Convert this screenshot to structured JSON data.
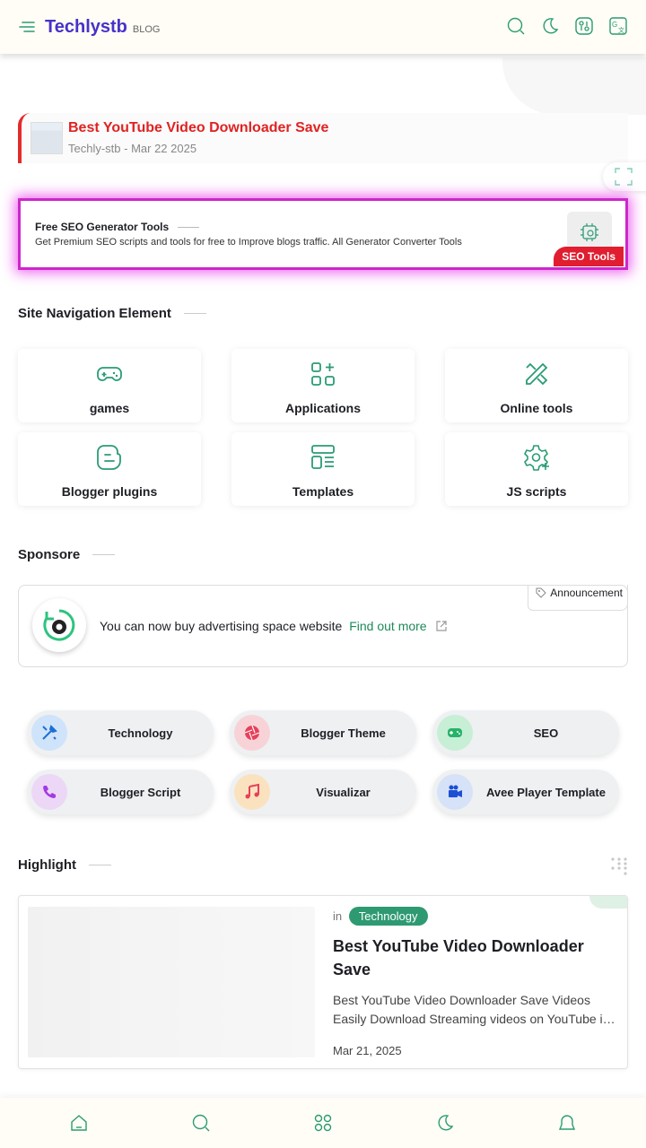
{
  "header": {
    "brand": "Techlystb",
    "brand_sub": "BLOG"
  },
  "recent_post": {
    "title": "Best YouTube Video Downloader Save",
    "meta": "Techly-stb - Mar 22 2025"
  },
  "seo_promo": {
    "title": "Free SEO Generator Tools",
    "description": "Get Premium SEO scripts and tools for free to Improve blogs traffic. All Generator Converter Tools",
    "badge": "SEO Tools"
  },
  "site_nav": {
    "heading": "Site Navigation Element",
    "items": [
      {
        "label": "games",
        "icon": "gamepad-icon"
      },
      {
        "label": "Applications",
        "icon": "apps-grid-icon"
      },
      {
        "label": "Online tools",
        "icon": "tools-icon"
      },
      {
        "label": "Blogger plugins",
        "icon": "blogger-icon"
      },
      {
        "label": "Templates",
        "icon": "template-icon"
      },
      {
        "label": "JS scripts",
        "icon": "settings-gear-icon"
      }
    ]
  },
  "sponsor": {
    "heading": "Sponsore",
    "text": "You can now buy advertising space website",
    "link": "Find out more",
    "badge": "Announcement"
  },
  "categories": [
    {
      "label": "Technology",
      "icon": "tools-icon",
      "color": "#cfe3fb"
    },
    {
      "label": "Blogger Theme",
      "icon": "aperture-icon",
      "color": "#f7d3d8"
    },
    {
      "label": "SEO",
      "icon": "gamepad-icon",
      "color": "#c6efd6"
    },
    {
      "label": "Blogger Script",
      "icon": "phone-icon",
      "color": "#ecd7f7"
    },
    {
      "label": "Visualizar",
      "icon": "music-icon",
      "color": "#fbe2bf"
    },
    {
      "label": "Avee Player Template",
      "icon": "video-camera-icon",
      "color": "#d6e2f7"
    }
  ],
  "highlight": {
    "heading": "Highlight",
    "post": {
      "in_label": "in",
      "tag": "Technology",
      "title": "Best YouTube Video Downloader Save",
      "snippet": "Best YouTube Video Downloader Save Videos Easily Download Streaming videos on YouTube i…",
      "date": "Mar 21, 2025"
    }
  },
  "colors": {
    "brand": "#4732c9",
    "accent_green": "#1e8a5a",
    "alert_red": "#e01e2f",
    "glow_magenta": "#cc27cc"
  }
}
